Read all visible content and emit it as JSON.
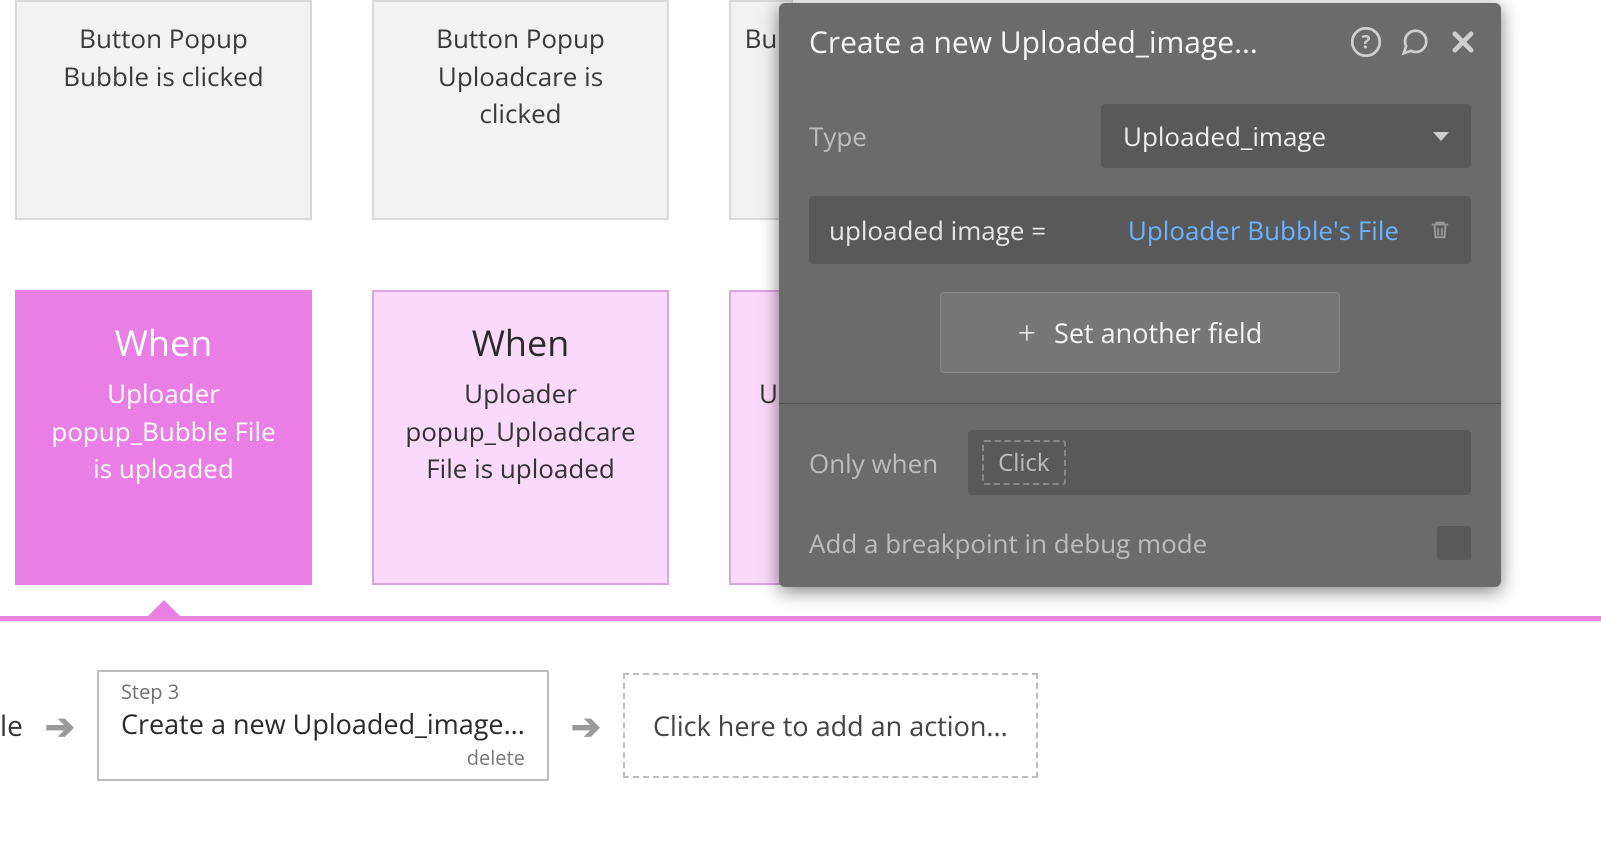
{
  "events": {
    "e1": "Button Popup Bubble is clicked",
    "e2": "Button Popup Uploadcare is clicked",
    "e3": "Bu"
  },
  "when_cards": {
    "title": "When",
    "w1": "Uploader popup_Bubble File is uploaded",
    "w2": "Uploader popup_Uploadcare File is uploaded",
    "w3": "U"
  },
  "steps": {
    "partial_left": "le",
    "step3_label": "Step 3",
    "step3_title": "Create a new Uploaded_image...",
    "delete_label": "delete",
    "add_action": "Click here to add an action..."
  },
  "panel": {
    "title": "Create a new Uploaded_image...",
    "type_label": "Type",
    "type_value": "Uploaded_image",
    "assign_lhs": "uploaded image  =",
    "assign_rhs": "Uploader Bubble's File",
    "set_another": "Set another field",
    "only_when_label": "Only when",
    "only_when_placeholder": "Click",
    "breakpoint_label": "Add a breakpoint in debug mode"
  }
}
